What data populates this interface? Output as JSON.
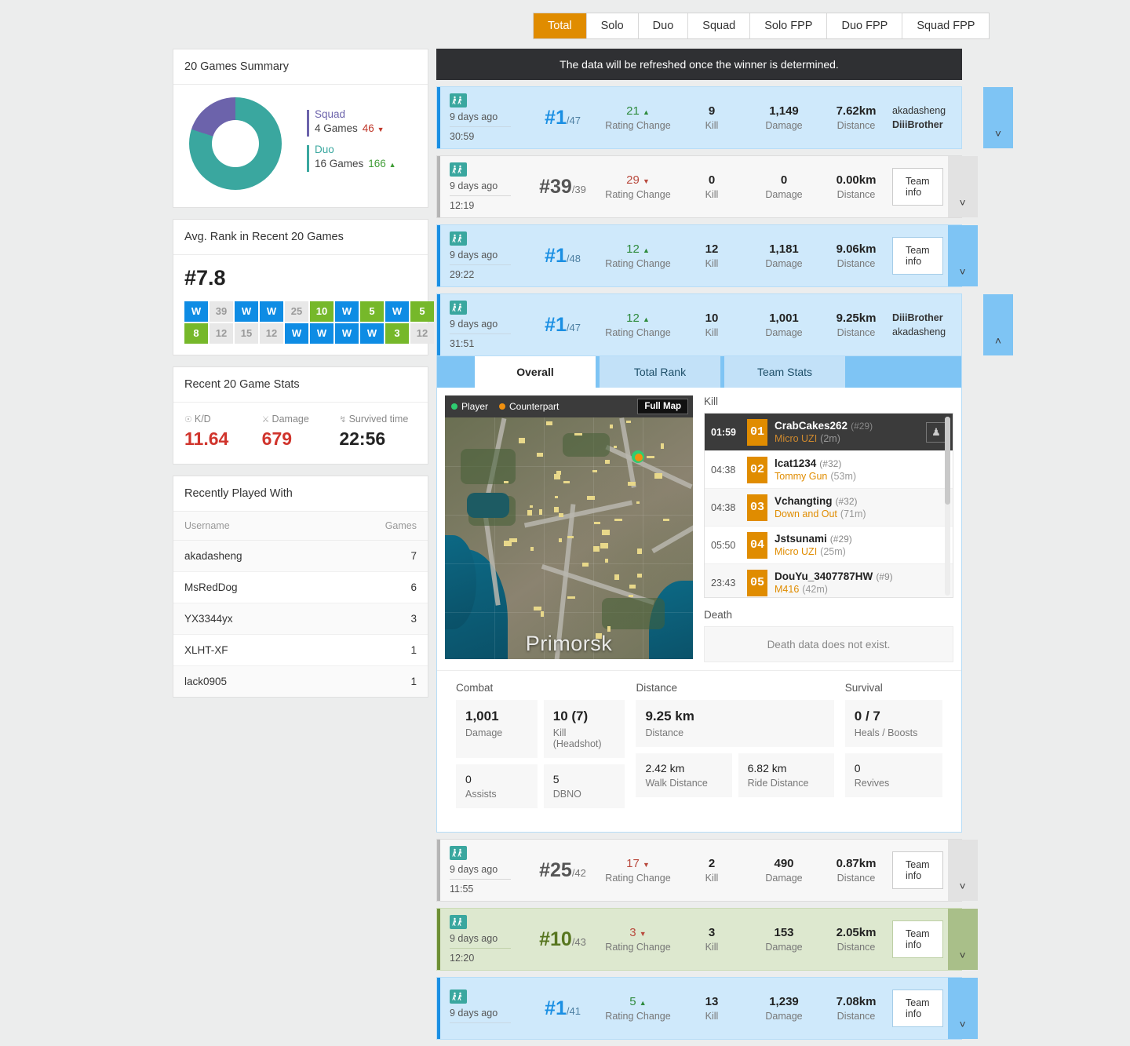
{
  "mode_tabs": [
    {
      "label": "Total",
      "active": true
    },
    {
      "label": "Solo",
      "active": false
    },
    {
      "label": "Duo",
      "active": false
    },
    {
      "label": "Squad",
      "active": false
    },
    {
      "label": "Solo FPP",
      "active": false
    },
    {
      "label": "Duo FPP",
      "active": false
    },
    {
      "label": "Squad FPP",
      "active": false
    }
  ],
  "summary": {
    "title": "20 Games Summary",
    "chart_data": {
      "type": "pie",
      "title": "20 Games Summary",
      "categories": [
        "Squad",
        "Duo"
      ],
      "values": [
        4,
        16
      ],
      "colors": [
        "#6c63ab",
        "#3aa79f"
      ],
      "legend_position": "right"
    },
    "legend": [
      {
        "name": "Squad",
        "games": "4 Games",
        "value": "46",
        "dir": "down",
        "caret": "▼",
        "color": "#6c63ab"
      },
      {
        "name": "Duo",
        "games": "16 Games",
        "value": "166",
        "dir": "up",
        "caret": "▲",
        "color": "#3aa79f"
      }
    ]
  },
  "avg_rank": {
    "title": "Avg. Rank in Recent 20 Games",
    "value": "#7.8",
    "cells": [
      {
        "label": "W",
        "type": "win"
      },
      {
        "label": "39",
        "type": "plain"
      },
      {
        "label": "W",
        "type": "win"
      },
      {
        "label": "W",
        "type": "win"
      },
      {
        "label": "25",
        "type": "plain"
      },
      {
        "label": "10",
        "type": "top"
      },
      {
        "label": "W",
        "type": "win"
      },
      {
        "label": "5",
        "type": "top"
      },
      {
        "label": "W",
        "type": "win"
      },
      {
        "label": "5",
        "type": "top"
      },
      {
        "label": "8",
        "type": "top"
      },
      {
        "label": "12",
        "type": "plain"
      },
      {
        "label": "15",
        "type": "plain"
      },
      {
        "label": "12",
        "type": "plain"
      },
      {
        "label": "W",
        "type": "win"
      },
      {
        "label": "W",
        "type": "win"
      },
      {
        "label": "W",
        "type": "win"
      },
      {
        "label": "W",
        "type": "win"
      },
      {
        "label": "3",
        "type": "top"
      },
      {
        "label": "12",
        "type": "plain"
      }
    ]
  },
  "recent_stats": {
    "title": "Recent 20 Game Stats",
    "items": [
      {
        "label": "K/D",
        "value": "11.64",
        "icon": "target-icon",
        "glyph": "☉",
        "dark": false
      },
      {
        "label": "Damage",
        "value": "679",
        "icon": "gun-icon",
        "glyph": "⚔",
        "dark": false
      },
      {
        "label": "Survived time",
        "value": "22:56",
        "icon": "runner-icon",
        "glyph": "↯",
        "dark": true
      }
    ]
  },
  "recently_played": {
    "title": "Recently Played With",
    "columns": [
      "Username",
      "Games"
    ],
    "rows": [
      {
        "username": "akadasheng",
        "games": "7"
      },
      {
        "username": "MsRedDog",
        "games": "6"
      },
      {
        "username": "YX3344yx",
        "games": "3"
      },
      {
        "username": "XLHT-XF",
        "games": "1"
      },
      {
        "username": "lack0905",
        "games": "1"
      }
    ]
  },
  "notice": "The data will be refreshed once the winner is determined.",
  "matches": [
    {
      "style": "win",
      "ago": "9 days ago",
      "duration": "30:59",
      "rank": "#1",
      "total": "/47",
      "rating": "21",
      "rating_dir": "up",
      "rating_caret": "▲",
      "rating_label": "Rating Change",
      "kill": "9",
      "kill_label": "Kill",
      "damage": "1,149",
      "damage_label": "Damage",
      "distance": "7.62km",
      "distance_label": "Distance",
      "team_mode": "names",
      "team_names": [
        {
          "name": "akadasheng",
          "bold": false
        },
        {
          "name": "DiiiBrother",
          "bold": true
        }
      ],
      "chevron": "▼"
    },
    {
      "style": "plain",
      "ago": "9 days ago",
      "duration": "12:19",
      "rank": "#39",
      "total": "/39",
      "rating": "29",
      "rating_dir": "down",
      "rating_caret": "▼",
      "rating_label": "Rating Change",
      "kill": "0",
      "kill_label": "Kill",
      "damage": "0",
      "damage_label": "Damage",
      "distance": "0.00km",
      "distance_label": "Distance",
      "team_mode": "button",
      "team_button": "Team info",
      "chevron": "▼"
    },
    {
      "style": "win",
      "ago": "9 days ago",
      "duration": "29:22",
      "rank": "#1",
      "total": "/48",
      "rating": "12",
      "rating_dir": "up",
      "rating_caret": "▲",
      "rating_label": "Rating Change",
      "kill": "12",
      "kill_label": "Kill",
      "damage": "1,181",
      "damage_label": "Damage",
      "distance": "9.06km",
      "distance_label": "Distance",
      "team_mode": "button",
      "team_button": "Team info",
      "chevron": "▼"
    },
    {
      "style": "win",
      "ago": "9 days ago",
      "duration": "31:51",
      "rank": "#1",
      "total": "/47",
      "rating": "12",
      "rating_dir": "up",
      "rating_caret": "▲",
      "rating_label": "Rating Change",
      "kill": "10",
      "kill_label": "Kill",
      "damage": "1,001",
      "damage_label": "Damage",
      "distance": "9.25km",
      "distance_label": "Distance",
      "team_mode": "names",
      "team_names": [
        {
          "name": "DiiiBrother",
          "bold": true
        },
        {
          "name": "akadasheng",
          "bold": false
        }
      ],
      "chevron": "▲",
      "expanded": true
    }
  ],
  "detail": {
    "tabs": [
      {
        "label": "Overall",
        "active": true
      },
      {
        "label": "Total Rank",
        "active": false
      },
      {
        "label": "Team Stats",
        "active": false
      }
    ],
    "map": {
      "legend_player": "Player",
      "legend_counterpart": "Counterpart",
      "full_map_button": "Full Map",
      "town_label": "Primorsk"
    },
    "kill_title": "Kill",
    "kills": [
      {
        "time": "01:59",
        "index": "01",
        "name": "CrabCakes262",
        "rank": "(#29)",
        "weapon": "Micro UZI",
        "dist": "(2m)",
        "highlight": true
      },
      {
        "time": "04:38",
        "index": "02",
        "name": "lcat1234",
        "rank": "(#32)",
        "weapon": "Tommy Gun",
        "dist": "(53m)",
        "highlight": false
      },
      {
        "time": "04:38",
        "index": "03",
        "name": "Vchangting",
        "rank": "(#32)",
        "weapon": "Down and Out",
        "dist": "(71m)",
        "highlight": false
      },
      {
        "time": "05:50",
        "index": "04",
        "name": "Jstsunami",
        "rank": "(#29)",
        "weapon": "Micro UZI",
        "dist": "(25m)",
        "highlight": false
      },
      {
        "time": "23:43",
        "index": "05",
        "name": "DouYu_3407787HW",
        "rank": "(#9)",
        "weapon": "M416",
        "dist": "(42m)",
        "highlight": false
      }
    ],
    "death_title": "Death",
    "death_empty": "Death data does not exist.",
    "groups": [
      {
        "title": "Combat",
        "rows": [
          [
            {
              "value": "1,001",
              "key": "Damage",
              "bold": true
            },
            {
              "value": "10 (7)",
              "key": "Kill (Headshot)",
              "bold": true
            }
          ],
          [
            {
              "value": "0",
              "key": "Assists",
              "bold": false
            },
            {
              "value": "5",
              "key": "DBNO",
              "bold": false
            }
          ]
        ]
      },
      {
        "title": "Distance",
        "rows": [
          [
            {
              "value": "9.25 km",
              "key": "Distance",
              "bold": true,
              "full": true
            }
          ],
          [
            {
              "value": "2.42 km",
              "key": "Walk Distance",
              "bold": false
            },
            {
              "value": "6.82 km",
              "key": "Ride Distance",
              "bold": false
            }
          ]
        ]
      },
      {
        "title": "Survival",
        "rows": [
          [
            {
              "value": "0 / 7",
              "key": "Heals / Boosts",
              "bold": true
            }
          ],
          [
            {
              "value": "0",
              "key": "Revives",
              "bold": false
            }
          ]
        ]
      }
    ]
  },
  "matches_bottom": [
    {
      "style": "plain",
      "ago": "9 days ago",
      "duration": "11:55",
      "rank": "#25",
      "total": "/42",
      "rating": "17",
      "rating_dir": "down",
      "rating_caret": "▼",
      "rating_label": "Rating Change",
      "kill": "2",
      "kill_label": "Kill",
      "damage": "490",
      "damage_label": "Damage",
      "distance": "0.87km",
      "distance_label": "Distance",
      "team_mode": "button",
      "team_button": "Team info",
      "chevron": "▼"
    },
    {
      "style": "top",
      "ago": "9 days ago",
      "duration": "12:20",
      "rank": "#10",
      "total": "/43",
      "rating": "3",
      "rating_dir": "down",
      "rating_caret": "▼",
      "rating_label": "Rating Change",
      "kill": "3",
      "kill_label": "Kill",
      "damage": "153",
      "damage_label": "Damage",
      "distance": "2.05km",
      "distance_label": "Distance",
      "team_mode": "button",
      "team_button": "Team info",
      "chevron": "▼"
    },
    {
      "style": "win",
      "ago": "9 days ago",
      "duration": "",
      "rank": "#1",
      "total": "/41",
      "rating": "5",
      "rating_dir": "up",
      "rating_caret": "▲",
      "rating_label": "Rating Change",
      "kill": "13",
      "kill_label": "Kill",
      "damage": "1,239",
      "damage_label": "Damage",
      "distance": "7.08km",
      "distance_label": "Distance",
      "team_mode": "button",
      "team_button": "Team info",
      "chevron": "▼"
    }
  ]
}
